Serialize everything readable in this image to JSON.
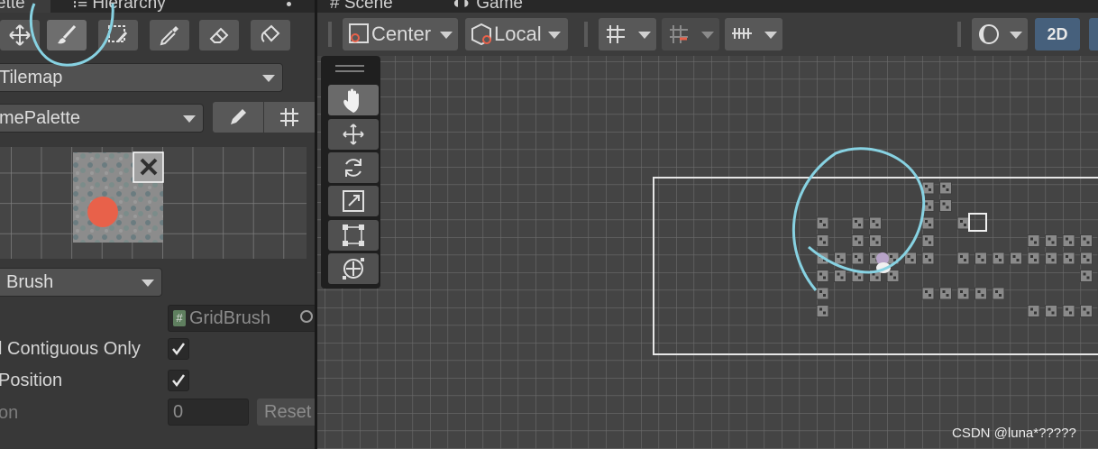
{
  "left_panel": {
    "tabs": {
      "palette": "ette",
      "hierarchy": "Hierarchy"
    },
    "tools": [
      "select-tool",
      "paint-brush",
      "box-fill",
      "picker",
      "eraser",
      "fill-bucket"
    ],
    "tilemap_dropdown": "Tilemap",
    "palette_dropdown": "mePalette",
    "brush_dropdown": "Brush",
    "brush_asset": "GridBrush",
    "props": {
      "contiguous_label": "l Contiguous Only",
      "position_label": "Position",
      "on_label": "on",
      "on_value": "0",
      "reset_label": "Reset"
    }
  },
  "scene": {
    "tabs": {
      "scene": "Scene",
      "game": "Game"
    },
    "toolbar": {
      "pivot_mode": "Center",
      "pivot_rotation": "Local",
      "mode_2d": "2D"
    },
    "vertical_tools": [
      "hand-tool",
      "move-tool",
      "rotate-tool",
      "scale-tool",
      "rect-tool",
      "transform-tool"
    ]
  },
  "watermark": "CSDN @luna*?????",
  "colors": {
    "annotation": "#87d2e2",
    "accent_2d": "#46607c"
  }
}
